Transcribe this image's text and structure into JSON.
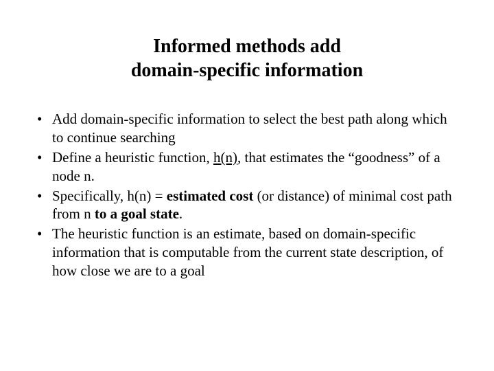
{
  "title_line1": "Informed methods add",
  "title_line2": "domain-specific information",
  "bullets": {
    "b1": "Add domain-specific information to select the best path along which to continue searching",
    "b2_pre": "Define a heuristic function, ",
    "b2_hn": "h(n)",
    "b2_post": ", that estimates the “goodness” of a node n.",
    "b3_pre": "Specifically, h(n) = ",
    "b3_est": "estimated cost",
    "b3_mid": " (or distance) of minimal cost path from n ",
    "b3_goal": "to a goal state",
    "b3_end": ".",
    "b4": "The heuristic function is an estimate, based on domain-specific information that is computable from the current state description, of how close we are to a goal"
  }
}
